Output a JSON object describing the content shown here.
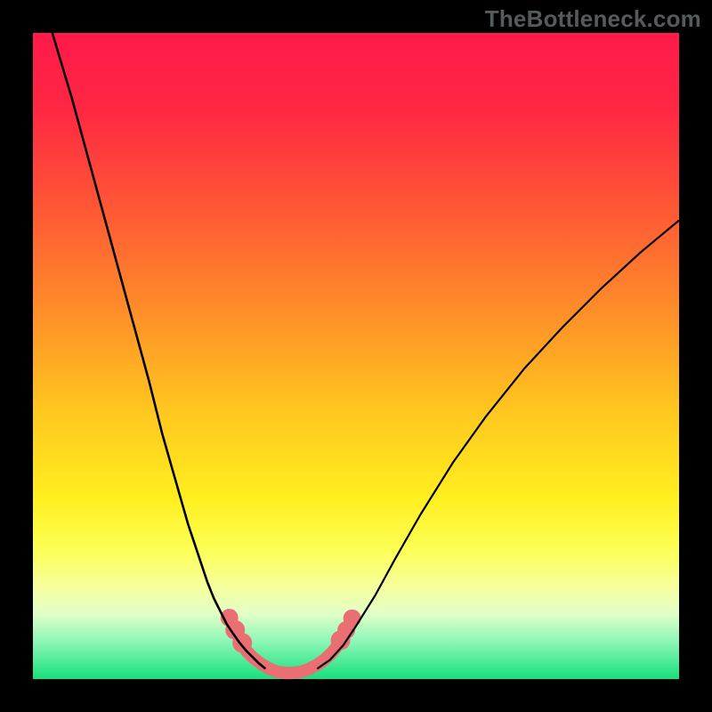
{
  "watermark": "TheBottleneck.com",
  "chart_data": {
    "type": "line",
    "title": "",
    "xlabel": "",
    "ylabel": "",
    "xlim": [
      0,
      100
    ],
    "ylim": [
      0,
      100
    ],
    "gradient_stops": [
      {
        "offset": 0.0,
        "color": "#ff1a49"
      },
      {
        "offset": 0.12,
        "color": "#ff2843"
      },
      {
        "offset": 0.28,
        "color": "#ff5a34"
      },
      {
        "offset": 0.42,
        "color": "#ff8a2a"
      },
      {
        "offset": 0.58,
        "color": "#ffc51f"
      },
      {
        "offset": 0.72,
        "color": "#ffef1f"
      },
      {
        "offset": 0.8,
        "color": "#fcff55"
      },
      {
        "offset": 0.86,
        "color": "#f6ffa0"
      },
      {
        "offset": 0.9,
        "color": "#dfffc8"
      },
      {
        "offset": 0.94,
        "color": "#90f7b8"
      },
      {
        "offset": 1.0,
        "color": "#16e07c"
      }
    ],
    "series": [
      {
        "name": "left-curve",
        "color": "#000000",
        "width": 2.6,
        "x": [
          3,
          6,
          9,
          12,
          15,
          18,
          20,
          22,
          24,
          26,
          27,
          28,
          29,
          30,
          31,
          32,
          33,
          34,
          35,
          36
        ],
        "y": [
          100,
          90,
          79,
          68,
          57,
          46,
          38,
          31,
          24,
          18,
          15,
          12.5,
          10.5,
          8.5,
          7.0,
          5.6,
          4.4,
          3.4,
          2.4,
          1.6
        ]
      },
      {
        "name": "right-curve",
        "color": "#000000",
        "width": 2.2,
        "x": [
          44,
          46,
          48,
          50,
          53,
          56,
          60,
          65,
          70,
          76,
          82,
          88,
          94,
          100
        ],
        "y": [
          1.6,
          3.0,
          5.2,
          8.2,
          13.0,
          18.5,
          25.5,
          33.5,
          40.5,
          48.0,
          54.5,
          60.5,
          66.0,
          71.0
        ]
      },
      {
        "name": "bottom-link",
        "color": "#e96f73",
        "width": 14,
        "linecap": "round",
        "x": [
          33.0,
          34.2,
          35.4,
          36.6,
          37.8,
          39.0,
          40.2,
          41.4,
          42.6,
          43.8,
          45.0,
          46.2,
          47.0
        ],
        "y": [
          4.4,
          3.2,
          2.3,
          1.6,
          1.15,
          0.95,
          0.95,
          1.1,
          1.5,
          2.1,
          2.9,
          4.0,
          5.0
        ]
      }
    ],
    "markers": [
      {
        "name": "left-dot-1",
        "x": 32.4,
        "y": 5.6,
        "r": 11,
        "color": "#e96f73"
      },
      {
        "name": "left-dot-2",
        "x": 31.3,
        "y": 7.6,
        "r": 11,
        "color": "#e96f73"
      },
      {
        "name": "left-dot-3",
        "x": 30.4,
        "y": 9.5,
        "r": 10,
        "color": "#e96f73"
      },
      {
        "name": "right-dot-1",
        "x": 47.6,
        "y": 6.0,
        "r": 11,
        "color": "#e96f73"
      },
      {
        "name": "right-dot-2",
        "x": 48.5,
        "y": 7.6,
        "r": 10,
        "color": "#e96f73"
      },
      {
        "name": "right-dot-3",
        "x": 49.4,
        "y": 9.4,
        "r": 10,
        "color": "#e96f73"
      }
    ]
  }
}
